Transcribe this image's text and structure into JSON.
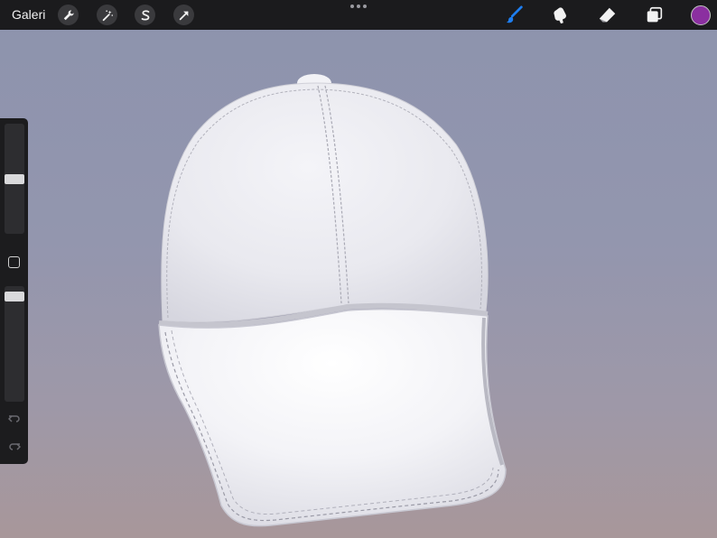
{
  "toolbar": {
    "gallery_label": "Galeri",
    "left_tools": [
      {
        "name": "actions",
        "icon": "wrench-icon"
      },
      {
        "name": "adjustments",
        "icon": "magic-wand-icon"
      },
      {
        "name": "selection",
        "icon": "selection-s-icon"
      },
      {
        "name": "transform",
        "icon": "arrow-cursor-icon"
      }
    ],
    "center_menu_icon": "more-dots-icon",
    "right_tools": [
      {
        "name": "brush",
        "icon": "brush-icon",
        "active": true
      },
      {
        "name": "smudge",
        "icon": "smudge-icon",
        "active": false
      },
      {
        "name": "eraser",
        "icon": "eraser-icon",
        "active": false
      },
      {
        "name": "layers",
        "icon": "layers-icon",
        "active": false
      }
    ],
    "current_color": "#8b2fa0"
  },
  "sidebar": {
    "brush_size_level": 0.5,
    "opacity_level": 0.05,
    "modify_icon": "square-modify-icon",
    "undo_icon": "undo-arrow-icon",
    "redo_icon": "redo-arrow-icon"
  },
  "canvas": {
    "subject_icon": "baseball-cap-3d-model",
    "background_top": "#8d93ad",
    "background_bottom": "#a8979a",
    "accent_active_tool": "#1e7ef0"
  }
}
